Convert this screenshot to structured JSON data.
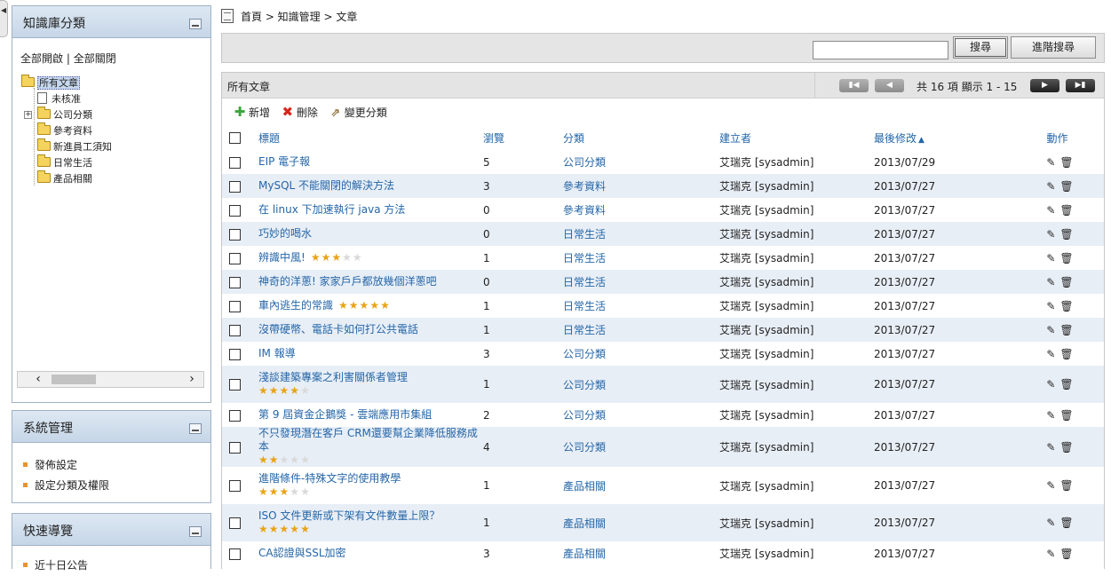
{
  "sidebar": {
    "kb": {
      "title": "知識庫分類",
      "expand_all": "全部開啟",
      "separator": "|",
      "collapse_all": "全部關閉",
      "tree": [
        {
          "label": "所有文章",
          "selected": true,
          "icon": "folder-open-icon"
        },
        {
          "label": "未核准",
          "icon": "document-icon"
        },
        {
          "label": "公司分類",
          "icon": "folder-icon",
          "expandable": true
        },
        {
          "label": "參考資料",
          "icon": "folder-icon"
        },
        {
          "label": "新進員工須知",
          "icon": "folder-icon"
        },
        {
          "label": "日常生活",
          "icon": "folder-icon"
        },
        {
          "label": "產品相關",
          "icon": "folder-icon"
        }
      ]
    },
    "sys": {
      "title": "系統管理",
      "items": [
        "發佈設定",
        "設定分類及權限"
      ]
    },
    "nav": {
      "title": "快速導覽",
      "items": [
        "近十日公告"
      ]
    }
  },
  "breadcrumb": "首頁 > 知識管理 > 文章",
  "search": {
    "value": "",
    "search_label": "搜尋",
    "advanced_label": "進階搜尋"
  },
  "list": {
    "title": "所有文章",
    "pager": {
      "info": "共 16 項 顯示 1 - 15",
      "first": "▮◀",
      "prev": "◀",
      "next": "▶",
      "last": "▶▮"
    },
    "toolbar": {
      "add": "新增",
      "delete": "刪除",
      "change_category": "變更分類"
    },
    "columns": {
      "title": "標題",
      "views": "瀏覽",
      "category": "分類",
      "creator": "建立者",
      "modified": "最後修改",
      "action": "動作"
    },
    "colors": {
      "link": "#2466a8",
      "row_alt": "#e8eef6",
      "star": "#e8a317"
    },
    "rows": [
      {
        "title": "EIP 電子報",
        "views": "5",
        "category": "公司分類",
        "creator": "艾瑞克 [sysadmin]",
        "modified": "2013/07/29"
      },
      {
        "title": "MySQL 不能關閉的解決方法",
        "views": "3",
        "category": "參考資料",
        "creator": "艾瑞克 [sysadmin]",
        "modified": "2013/07/27"
      },
      {
        "title": "在 linux 下加速執行 java 方法",
        "views": "0",
        "category": "參考資料",
        "creator": "艾瑞克 [sysadmin]",
        "modified": "2013/07/27"
      },
      {
        "title": "巧妙的喝水",
        "views": "0",
        "category": "日常生活",
        "creator": "艾瑞克 [sysadmin]",
        "modified": "2013/07/27"
      },
      {
        "title": "辨識中風!",
        "rating": 3,
        "views": "1",
        "category": "日常生活",
        "creator": "艾瑞克 [sysadmin]",
        "modified": "2013/07/27"
      },
      {
        "title": "神奇的洋蔥! 家家戶戶都放幾個洋蔥吧",
        "views": "0",
        "category": "日常生活",
        "creator": "艾瑞克 [sysadmin]",
        "modified": "2013/07/27"
      },
      {
        "title": "車內逃生的常識",
        "rating": 5,
        "views": "1",
        "category": "日常生活",
        "creator": "艾瑞克 [sysadmin]",
        "modified": "2013/07/27"
      },
      {
        "title": "沒帶硬幣、電話卡如何打公共電話",
        "views": "1",
        "category": "日常生活",
        "creator": "艾瑞克 [sysadmin]",
        "modified": "2013/07/27"
      },
      {
        "title": "IM 報導",
        "views": "3",
        "category": "公司分類",
        "creator": "艾瑞克 [sysadmin]",
        "modified": "2013/07/27"
      },
      {
        "title": "淺談建築專案之利害關係者管理",
        "rating": 4,
        "views": "1",
        "category": "公司分類",
        "creator": "艾瑞克 [sysadmin]",
        "modified": "2013/07/27"
      },
      {
        "title": "第 9 屆資金企鵝獎 - 雲端應用市集組",
        "views": "2",
        "category": "公司分類",
        "creator": "艾瑞克 [sysadmin]",
        "modified": "2013/07/27"
      },
      {
        "title": "不只發現潛在客戶 CRM還要幫企業降低服務成本",
        "rating": 2,
        "views": "4",
        "category": "公司分類",
        "creator": "艾瑞克 [sysadmin]",
        "modified": "2013/07/27"
      },
      {
        "title": "進階條件-特殊文字的使用教學",
        "rating": 3,
        "views": "1",
        "category": "產品相關",
        "creator": "艾瑞克 [sysadmin]",
        "modified": "2013/07/27"
      },
      {
        "title": "ISO 文件更新或下架有文件數量上限？",
        "rating": 5,
        "views": "1",
        "category": "產品相關",
        "creator": "艾瑞克 [sysadmin]",
        "modified": "2013/07/27"
      },
      {
        "title": "CA認證與SSL加密",
        "views": "3",
        "category": "產品相關",
        "creator": "艾瑞克 [sysadmin]",
        "modified": "2013/07/27"
      }
    ]
  }
}
